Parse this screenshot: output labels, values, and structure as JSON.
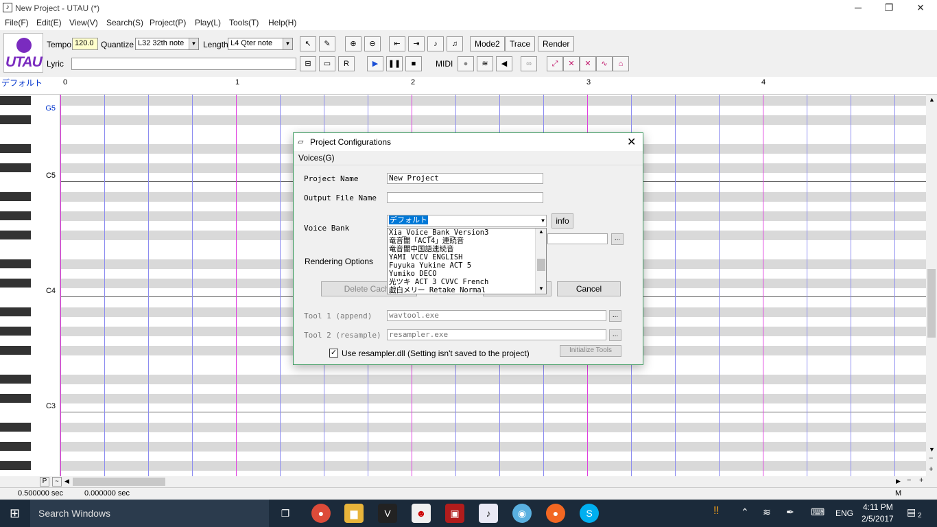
{
  "window": {
    "title": "New Project - UTAU (*)",
    "minimize": "─",
    "restore": "❐",
    "close": "✕"
  },
  "menu": [
    "File(F)",
    "Edit(E)",
    "View(V)",
    "Search(S)",
    "Project(P)",
    "Play(L)",
    "Tools(T)",
    "Help(H)"
  ],
  "toolbar": {
    "logo_text": "UTAU",
    "tempo_label": "Tempo",
    "tempo_value": "120.0",
    "quantize_label": "Quantize",
    "quantize_value": "L32 32th note",
    "length_label": "Length",
    "length_value": "L4  Qter note",
    "lyric_label": "Lyric",
    "lyric_value": "",
    "midi_label": "MIDI",
    "mode2": "Mode2",
    "trace": "Trace",
    "render": "Render",
    "accent_color": "#7a2bbf",
    "tempo_bg": "#ffffcc"
  },
  "ruler": {
    "track_name": "デフォルト",
    "measures": [
      "0",
      "1",
      "2",
      "3",
      "4"
    ]
  },
  "piano": {
    "labels": [
      "G5",
      "C5",
      "C4",
      "C3"
    ]
  },
  "scroll": {
    "p_button": "P",
    "m_label": "M"
  },
  "status": {
    "left": "0.500000 sec",
    "right": "0.000000 sec"
  },
  "dialog": {
    "title": "Project Configurations",
    "menu": "Voices(G)",
    "project_name_label": "Project Name",
    "project_name_value": "New Project",
    "output_label": "Output File Name",
    "output_value": "",
    "voicebank_label": "Voice Bank",
    "voicebank_selected": "デフォルト",
    "info_button": "info",
    "rendering_label": "Rendering Options",
    "delete_cache": "Delete Cache",
    "cancel": "Cancel",
    "tool1_label": "Tool 1 (append)",
    "tool1_value": "wavtool.exe",
    "tool2_label": "Tool 2 (resample)",
    "tool2_value": "resampler.exe",
    "browse": "...",
    "resampler_checkbox": "Use resampler.dll (Setting isn't saved to the project)",
    "resampler_checked": true,
    "init_tools": "Initialize Tools",
    "voicebank_list": [
      "Xia_Voice_Bank_Version3",
      "竜音闇「ACT4」連続音",
      "竜音闇中国語連続音",
      "YAMI VCCV ENGLISH",
      "Fuyuka Yukine ACT 5",
      "Yumiko DECO",
      "光ツキ ACT 3 CVVC French",
      "戯白メリー Retake Normal"
    ]
  },
  "taskbar": {
    "search_placeholder": "Search Windows",
    "language": "ENG",
    "time": "4:11 PM",
    "date": "2/5/2017",
    "notifications": "2"
  }
}
